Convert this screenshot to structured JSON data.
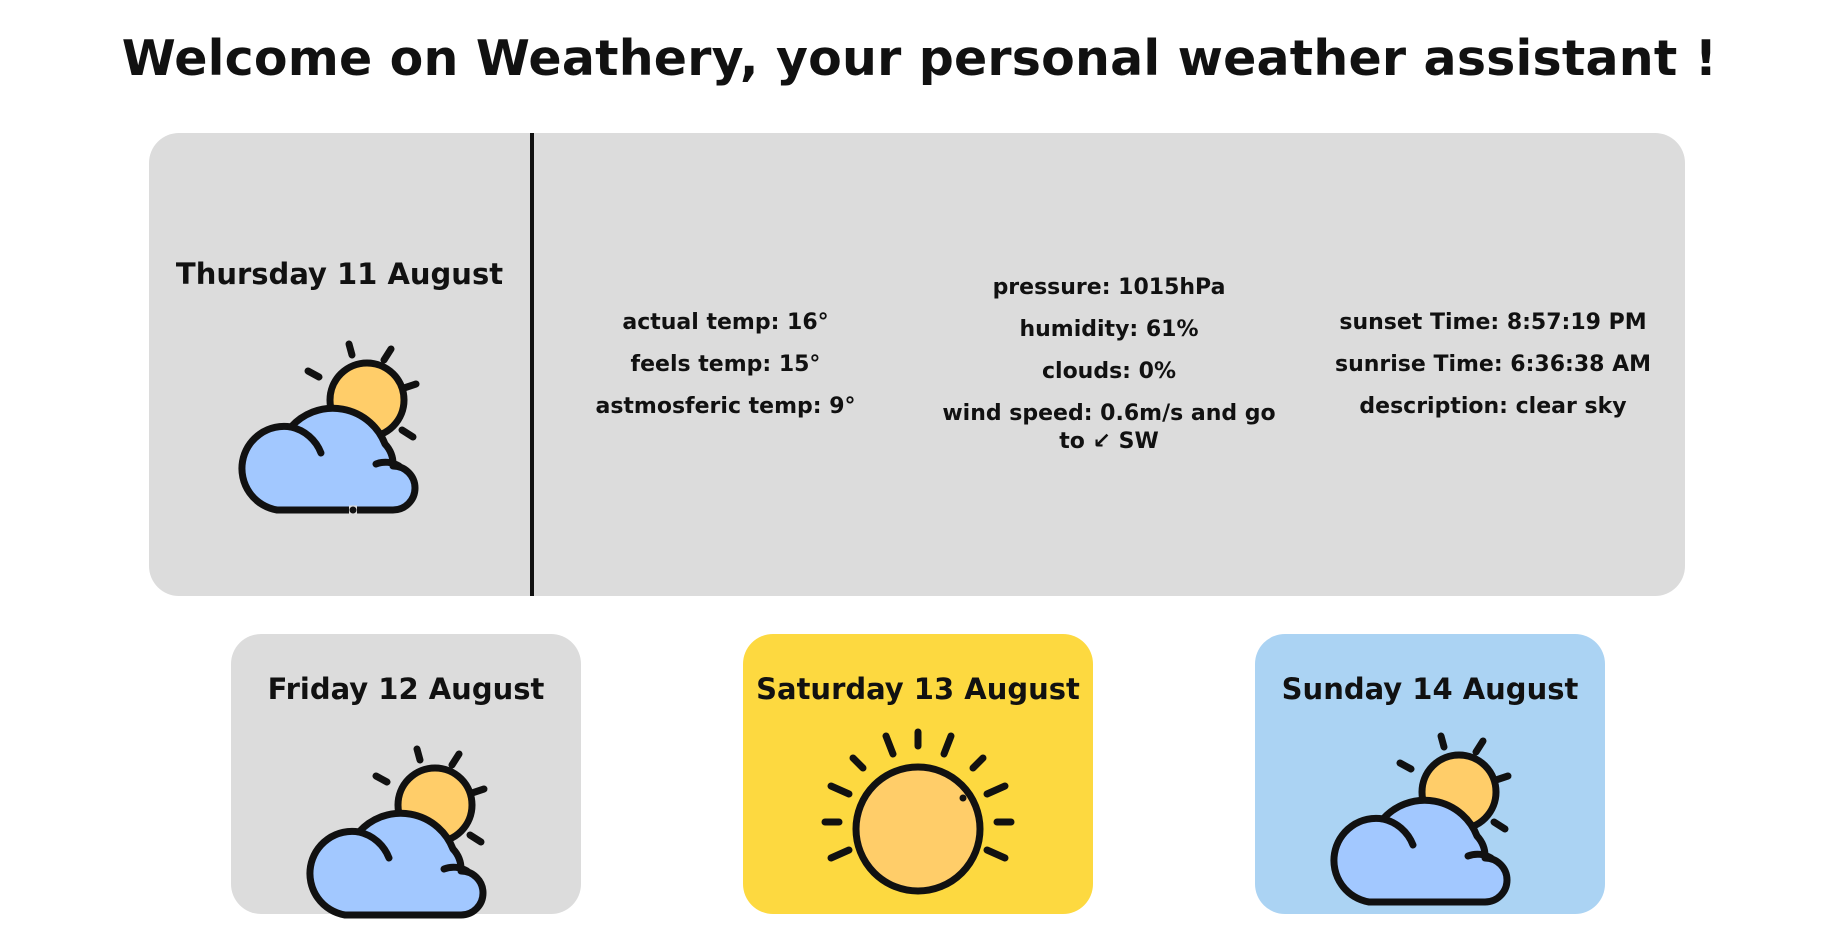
{
  "header": {
    "title": "Welcome on Weathery, your personal weather assistant !"
  },
  "today": {
    "date": "Thursday 11 August",
    "icon": "partly-cloudy-icon",
    "temps": {
      "actual": "actual temp: 16°",
      "feels": "feels temp: 15°",
      "atmospheric": "astmosferic temp: 9°"
    },
    "conditions": {
      "pressure": "pressure: 1015hPa",
      "humidity": "humidity: 61%",
      "clouds": "clouds: 0%",
      "wind": "wind speed: 0.6m/s and go to ↙ SW"
    },
    "sun": {
      "sunset": "sunset Time: 8:57:19 PM",
      "sunrise": "sunrise Time: 6:36:38 AM",
      "description": "description: clear sky"
    }
  },
  "forecast": [
    {
      "date": "Friday 12 August",
      "icon": "partly-cloudy-icon",
      "background": "#dcdcdc"
    },
    {
      "date": "Saturday 13 August",
      "icon": "sun-icon",
      "background": "#fdd940"
    },
    {
      "date": "Sunday 14 August",
      "icon": "partly-cloudy-icon",
      "background": "#abd3f3"
    }
  ],
  "colors": {
    "card_grey": "#dcdcdc",
    "card_yellow": "#fdd940",
    "card_blue": "#abd3f3",
    "sun": "#ffcd69",
    "cloud": "#a2c8ff"
  }
}
